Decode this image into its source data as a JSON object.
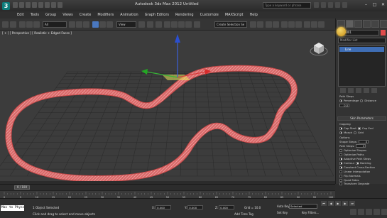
{
  "window": {
    "title": "Autodesk 3ds Max 2012     Untitled",
    "logo": "3ds-max-logo",
    "search_placeholder": "Type a keyword or phrase",
    "controls": [
      "–",
      "□",
      "✕"
    ]
  },
  "menus": [
    "Edit",
    "Tools",
    "Group",
    "Views",
    "Create",
    "Modifiers",
    "Animation",
    "Graph Editors",
    "Rendering",
    "Customize",
    "MAXScript",
    "Help"
  ],
  "toolbar": {
    "selection_filter": "All",
    "reference_coord": "View",
    "named_selection": "Create Selection Se"
  },
  "viewport": {
    "label": "[ + ] [ Perspective ] [ Realistic + Edged Faces ]",
    "object_color": "#e86b6b",
    "grid_color": "#2a2a2a",
    "background": "#3c3c3c"
  },
  "command_panel": {
    "object_name": "Line001",
    "modifier_list": "Modifier List",
    "stack_item": "Line",
    "rollout_interpolation": "Interpolation",
    "steps_label": "Steps:",
    "steps_value": "6",
    "optimize_label": "Optimize",
    "adaptive_label": "Adaptive",
    "rollout_skin": "Skin Parameters",
    "capping_label": "Capping",
    "cap_start": "Cap Start",
    "cap_end": "Cap End",
    "morph": "Morph",
    "grid": "Grid",
    "options_label": "Options",
    "shape_steps_label": "Shape Steps:",
    "shape_steps_value": "0",
    "path_steps_label": "Path Steps:",
    "path_steps_value": "0",
    "optimize_shapes": "Optimize Shapes",
    "optimize_paths": "Optimize Paths",
    "adaptive_path_steps": "Adaptive Path Steps",
    "contour": "Contour",
    "banking": "Banking",
    "constant_cross_section": "Constant Cross-Section",
    "linear_interpolation": "Linear Interpolation",
    "flip_normals": "Flip Normals",
    "quad_sides": "Quad Sides",
    "transform_degrade": "Transform Degrade",
    "path_label": "Path Steps",
    "percentage": "Percentage",
    "distance": "Distance",
    "path_value": "0.0"
  },
  "timeline": {
    "frame_display": "0 / 100",
    "ticks": [
      "0",
      "5",
      "10",
      "15",
      "20",
      "25",
      "30",
      "35",
      "40",
      "45",
      "50",
      "55",
      "60",
      "65",
      "70",
      "75",
      "80",
      "85",
      "90",
      "95",
      "100"
    ]
  },
  "status": {
    "script_text": "Max to Physc",
    "selection": "1 Object Selected",
    "prompt": "Click and drag to select and move objects",
    "x_label": "X:",
    "x_value": "0.000",
    "y_label": "Y:",
    "y_value": "0.000",
    "z_label": "Z:",
    "z_value": "0.000",
    "grid_label": "Grid = 10.0",
    "add_time_tag": "Add Time Tag",
    "auto_key": "Auto Key",
    "auto_key_mode": "Selected",
    "set_key": "Set Key",
    "key_filters": "Key Filters...",
    "frame": "0"
  }
}
